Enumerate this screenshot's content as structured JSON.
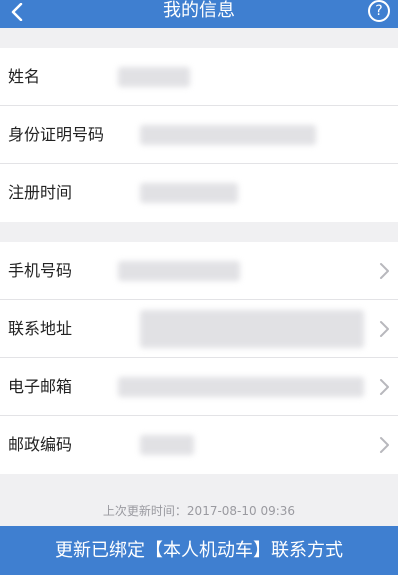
{
  "header": {
    "title": "我的信息",
    "back_icon": "chevron-left-icon",
    "help_icon": "question-circle-icon"
  },
  "profile": {
    "name_label": "姓名",
    "id_label": "身份证明号码",
    "reg_label": "注册时间"
  },
  "contact": {
    "phone_label": "手机号码",
    "address_label": "联系地址",
    "email_label": "电子邮箱",
    "postal_label": "邮政编码"
  },
  "footer": {
    "updated_text": "上次更新时间：2017-08-10 09:36",
    "cta_label": "更新已绑定【本人机动车】联系方式"
  },
  "colors": {
    "accent": "#3f7fd0",
    "background": "#f0f0f2"
  }
}
